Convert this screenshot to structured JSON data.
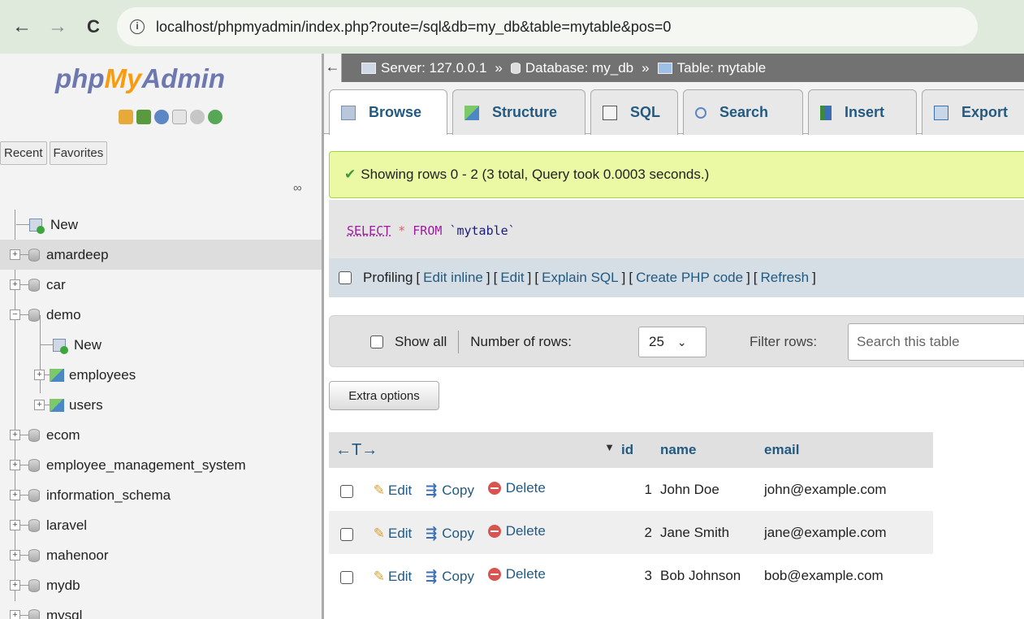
{
  "browser": {
    "url": "localhost/phpmyadmin/index.php?route=/sql&db=my_db&table=mytable&pos=0",
    "back": "←",
    "forward": "→",
    "reload": "C",
    "info": "i"
  },
  "sidebar": {
    "logo": {
      "php": "php",
      "my": "My",
      "admin": "Admin"
    },
    "recent_tab": "Recent",
    "favorites_tab": "Favorites",
    "link_icon": "∞",
    "tree": [
      {
        "label": "New",
        "type": "new",
        "expand": ""
      },
      {
        "label": "amardeep",
        "type": "db",
        "expand": "+"
      },
      {
        "label": "car",
        "type": "db",
        "expand": "+"
      },
      {
        "label": "demo",
        "type": "db",
        "expand": "−"
      },
      {
        "label": "New",
        "type": "new-child",
        "expand": ""
      },
      {
        "label": "employees",
        "type": "table",
        "expand": "+"
      },
      {
        "label": "users",
        "type": "table",
        "expand": "+"
      },
      {
        "label": "ecom",
        "type": "db",
        "expand": "+"
      },
      {
        "label": "employee_management_system",
        "type": "db",
        "expand": "+"
      },
      {
        "label": "information_schema",
        "type": "db",
        "expand": "+"
      },
      {
        "label": "laravel",
        "type": "db",
        "expand": "+"
      },
      {
        "label": "mahenoor",
        "type": "db",
        "expand": "+"
      },
      {
        "label": "mydb",
        "type": "db",
        "expand": "+"
      },
      {
        "label": "mysql",
        "type": "db",
        "expand": "+"
      }
    ]
  },
  "breadcrumb": {
    "collapse": "←",
    "server": "Server: 127.0.0.1",
    "database": "Database: my_db",
    "table": "Table: mytable",
    "sep": "»"
  },
  "tabs": [
    "Browse",
    "Structure",
    "SQL",
    "Search",
    "Insert",
    "Export"
  ],
  "message": {
    "check": "✔",
    "text": "Showing rows 0 - 2 (3 total, Query took 0.0003 seconds.)"
  },
  "sql": {
    "select": "SELECT",
    "star": "*",
    "from": "FROM",
    "table": "`mytable`"
  },
  "profiling": {
    "label": "Profiling",
    "links": [
      "Edit inline",
      "Edit",
      "Explain SQL",
      "Create PHP code",
      "Refresh"
    ]
  },
  "filter": {
    "show_all": "Show all",
    "rows_label": "Number of rows:",
    "rows_value": "25",
    "filter_label": "Filter rows:",
    "search_placeholder": "Search this table"
  },
  "extra_options": "Extra options",
  "table": {
    "arrows": "←T→",
    "sort_icon": "▼",
    "columns": [
      "id",
      "name",
      "email"
    ],
    "actions": {
      "edit": "Edit",
      "copy": "Copy",
      "delete": "Delete"
    },
    "rows": [
      {
        "id": "1",
        "name": "John Doe",
        "email": "john@example.com"
      },
      {
        "id": "2",
        "name": "Jane Smith",
        "email": "jane@example.com"
      },
      {
        "id": "3",
        "name": "Bob Johnson",
        "email": "bob@example.com"
      }
    ]
  }
}
